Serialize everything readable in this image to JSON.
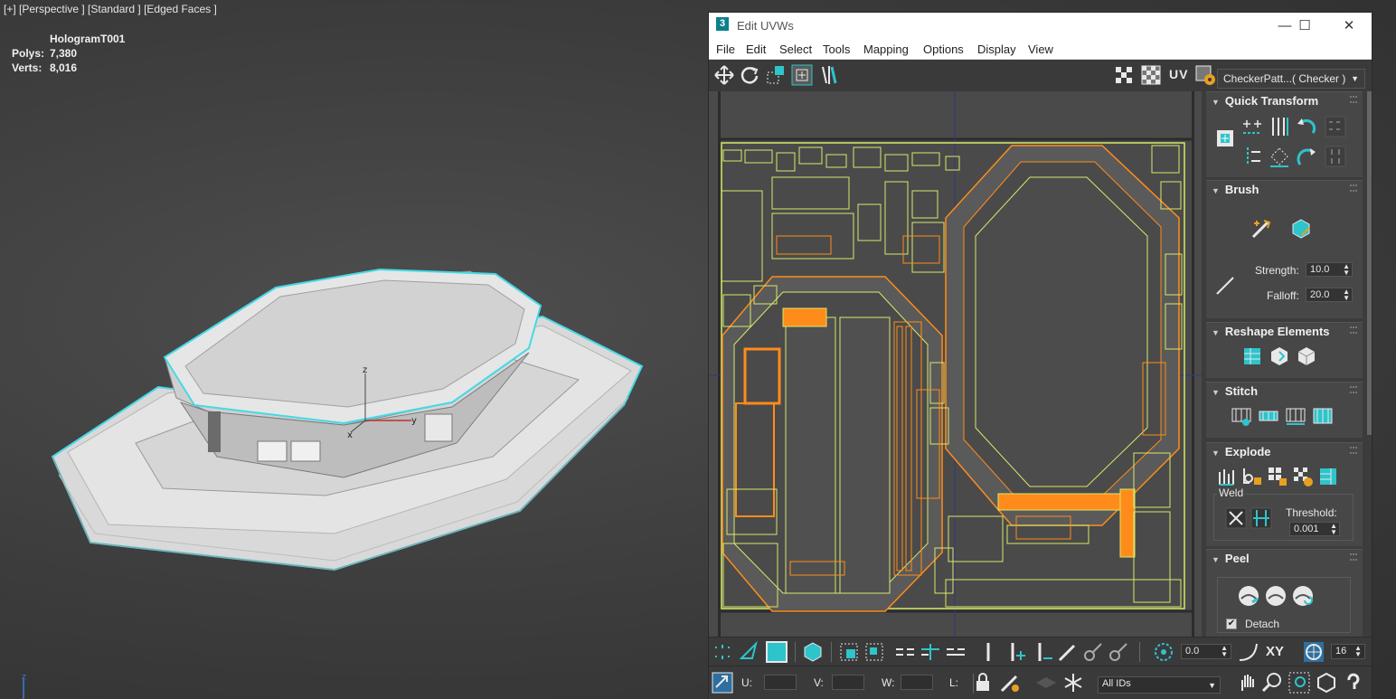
{
  "viewport": {
    "label": "[+] [Perspective ] [Standard ] [Edged Faces ]",
    "stats": {
      "object_name": "HologramT001",
      "polys_label": "Polys:",
      "polys_value": "7,380",
      "verts_label": "Verts:",
      "verts_value": "8,016"
    },
    "gizmo_axes": {
      "z": "z",
      "y": "y",
      "x": "x"
    },
    "corner_axis": "z"
  },
  "uvw_window": {
    "app_icon": "3",
    "title": "Edit UVWs",
    "window_buttons": {
      "minimize": "—",
      "maximize": "☐",
      "close": "✕"
    },
    "menu": [
      "File",
      "Edit",
      "Select",
      "Tools",
      "Mapping",
      "Options",
      "Display",
      "View"
    ],
    "toolbar_top": {
      "uv_label": "UV",
      "checker_select": "CheckerPatt...( Checker )",
      "icons": [
        "move-icon",
        "rotate-icon",
        "scale-icon",
        "freeform-icon",
        "mirror-icon",
        "checker-grid-icon",
        "checker-pattern-icon",
        "checker-settings-icon"
      ]
    },
    "rollouts": {
      "quick_transform": {
        "title": "Quick Transform"
      },
      "brush": {
        "title": "Brush",
        "strength_label": "Strength:",
        "strength_value": "10.0",
        "falloff_label": "Falloff:",
        "falloff_value": "20.0"
      },
      "reshape": {
        "title": "Reshape Elements"
      },
      "stitch": {
        "title": "Stitch"
      },
      "explode": {
        "title": "Explode",
        "weld_label": "Weld",
        "threshold_label": "Threshold:",
        "threshold_value": "0.001"
      },
      "peel": {
        "title": "Peel",
        "detach_label": "Detach",
        "detach_checked": true
      }
    },
    "bottom_toolbar": {
      "rotation_value": "0.0",
      "xy_label": "XY",
      "grid_value": "16",
      "u_label": "U:",
      "v_label": "V:",
      "w_label": "W:",
      "l_label": "L:",
      "ids_select": "All IDs"
    },
    "colors": {
      "uv_orange": "#ff8c1a",
      "uv_yellow": "#d8e86a",
      "accent_teal": "#2ec4cc"
    }
  }
}
